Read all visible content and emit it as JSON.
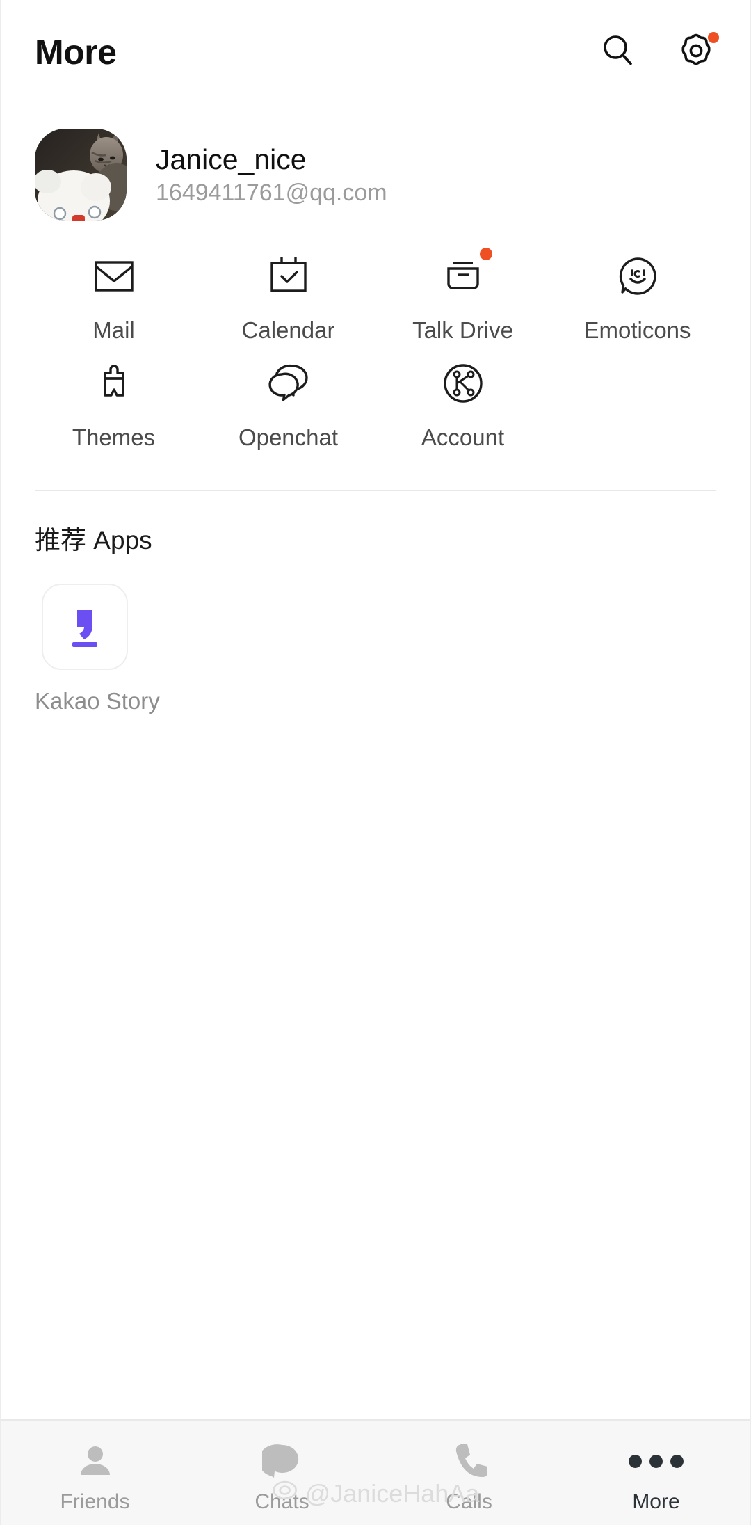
{
  "header": {
    "title": "More",
    "search_icon": "search-icon",
    "settings_icon": "gear-icon",
    "settings_badge": true,
    "badge_color": "#ee5023"
  },
  "profile": {
    "name": "Janice_nice",
    "email": "1649411761@qq.com",
    "avatar": "cat-photo-avatar"
  },
  "shortcuts": [
    {
      "label": "Mail",
      "icon": "envelope-icon",
      "badge": false
    },
    {
      "label": "Calendar",
      "icon": "calendar-check-icon",
      "badge": false
    },
    {
      "label": "Talk Drive",
      "icon": "drive-box-icon",
      "badge": true
    },
    {
      "label": "Emoticons",
      "icon": "smiley-bubble-icon",
      "badge": false
    },
    {
      "label": "Themes",
      "icon": "paintbrush-icon",
      "badge": false
    },
    {
      "label": "Openchat",
      "icon": "double-speech-bubble-icon",
      "badge": false
    },
    {
      "label": "Account",
      "icon": "kakao-account-node-icon",
      "badge": false
    }
  ],
  "apps": {
    "section_title": "推荐 Apps",
    "items": [
      {
        "label": "Kakao Story",
        "icon": "kakao-story-icon",
        "color": "#6c4ff2"
      }
    ]
  },
  "bottom_nav": {
    "active": "More",
    "items": [
      {
        "label": "Friends",
        "icon": "person-icon"
      },
      {
        "label": "Chats",
        "icon": "speech-bubble-icon"
      },
      {
        "label": "Calls",
        "icon": "phone-icon"
      },
      {
        "label": "More",
        "icon": "ellipsis-icon"
      }
    ]
  },
  "watermark": {
    "text": "@JaniceHahAa",
    "icon": "weibo-eye-icon"
  }
}
